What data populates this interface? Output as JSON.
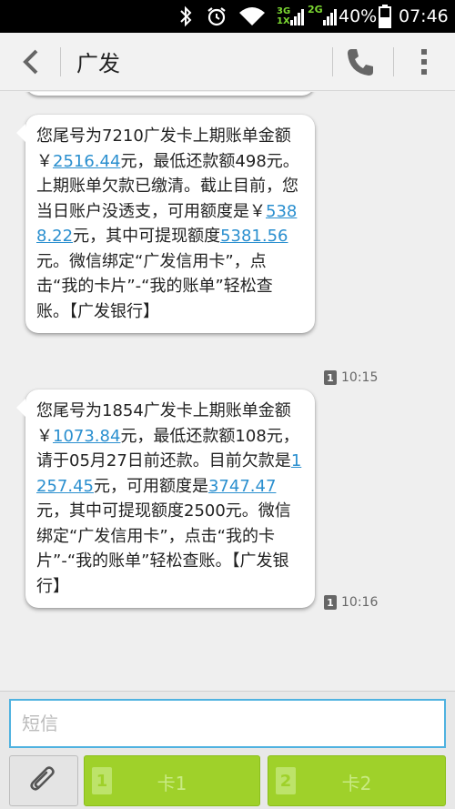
{
  "status_bar": {
    "network_1": "3G",
    "network_1_sub": "1X",
    "network_2": "2G",
    "battery": "40%",
    "time": "07:46"
  },
  "header": {
    "title": "广发",
    "back_icon": "back-arrow-icon",
    "call_icon": "phone-icon",
    "menu_icon": "overflow-menu-icon"
  },
  "messages": [
    {
      "parts": [
        {
          "t": "您尾号为7210广发卡上期账单金额￥"
        },
        {
          "n": "2516.44"
        },
        {
          "t": "元，最低还款额498元。上期账单欠款已缴清。截止目前，您当日账户没透支，可用额度是￥"
        },
        {
          "n": "5388.22"
        },
        {
          "t": "元，其中可提现额度"
        },
        {
          "n": "5381.56"
        },
        {
          "t": "元。微信绑定“广发信用卡”，点击“我的卡片”-“我的账单”轻松查账。【广发银行】"
        }
      ],
      "sim": "1",
      "time": "10:15"
    },
    {
      "parts": [
        {
          "t": "您尾号为1854广发卡上期账单金额￥"
        },
        {
          "n": "1073.84"
        },
        {
          "t": "元，最低还款额108元，请于05月27日前还款。目前欠款是"
        },
        {
          "n": "1257.45"
        },
        {
          "t": "元，可用额度是"
        },
        {
          "n": "3747.47"
        },
        {
          "t": "元，其中可提现额度2500元。微信绑定“广发信用卡”，点击“我的卡片”-“我的账单”轻松查账。【广发银行】"
        }
      ],
      "sim": "1",
      "time": "10:16"
    }
  ],
  "compose": {
    "placeholder": "短信",
    "attach_icon": "paperclip-icon",
    "send_sim1": {
      "badge": "1",
      "label": "卡1"
    },
    "send_sim2": {
      "badge": "2",
      "label": "卡2"
    }
  },
  "colors": {
    "link": "#2a8fcf",
    "send_button": "#9fd12a",
    "input_border": "#4fb2e0"
  }
}
